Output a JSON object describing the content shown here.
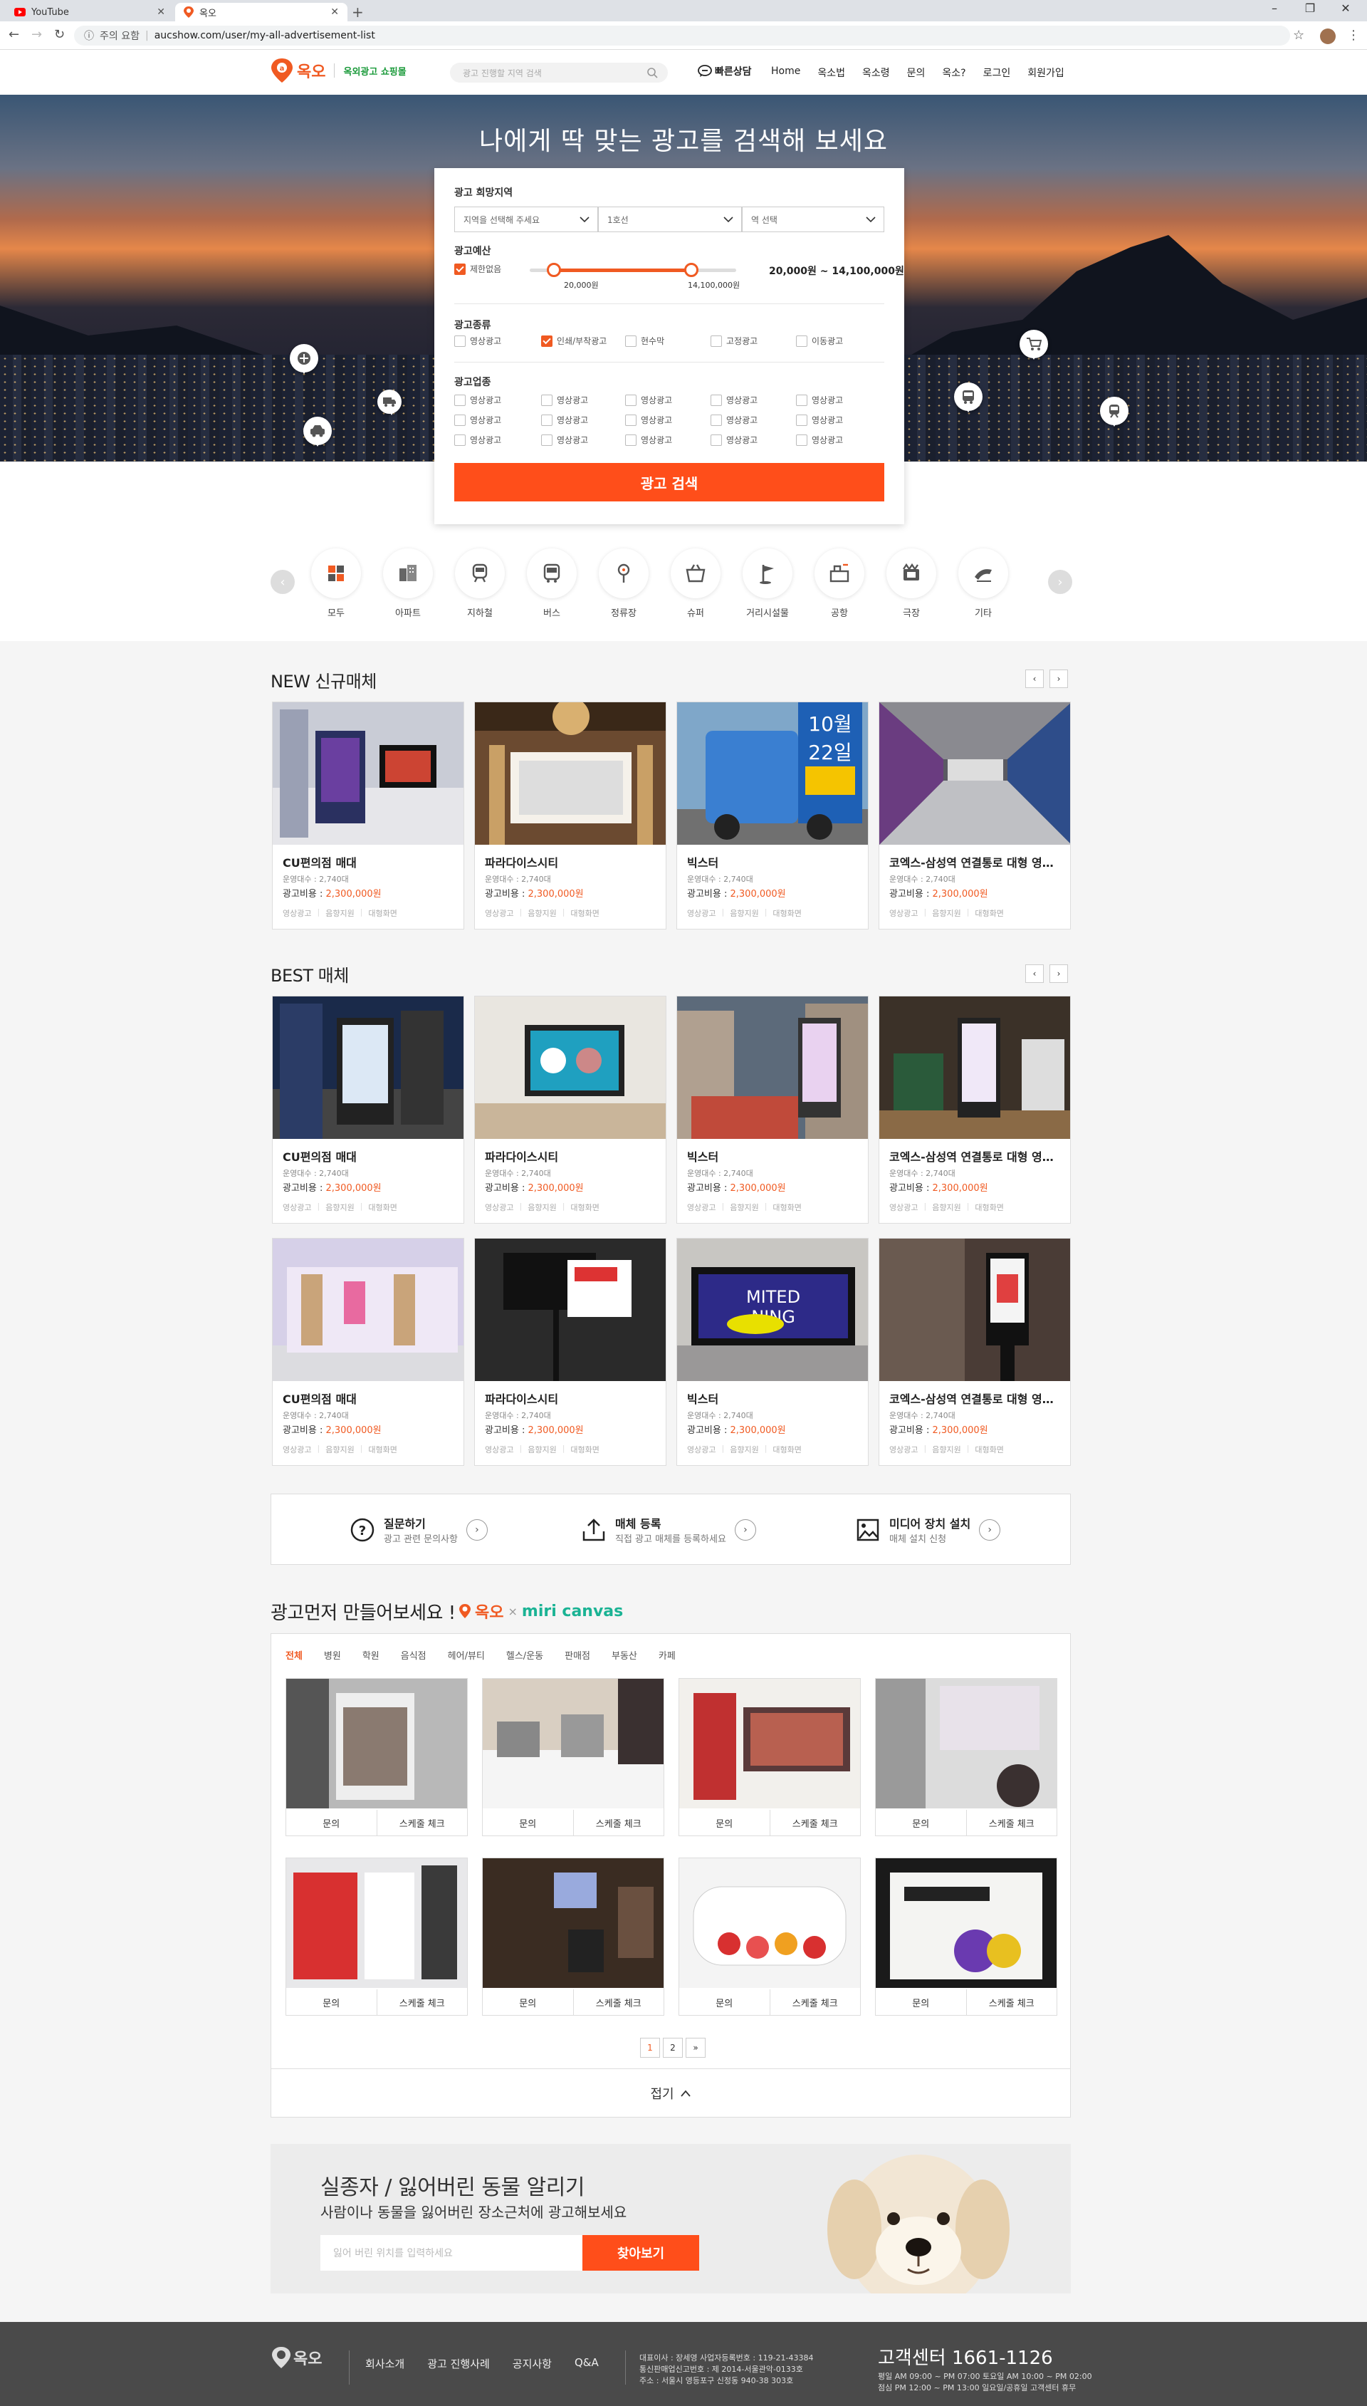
{
  "browser": {
    "tabs": [
      {
        "label": "YouTube"
      },
      {
        "label": "옥오"
      }
    ],
    "security": "주의 요함",
    "url": "aucshow.com/user/my-all-advertisement-list"
  },
  "header": {
    "logo_text": "옥오",
    "logo_sub": "옥외광고 쇼핑몰",
    "search_placeholder": "광고 진행할 지역 검색",
    "quick_label": "빠른상담",
    "nav": [
      "Home",
      "옥소법",
      "옥소령",
      "문의",
      "옥소?",
      "로그인",
      "회원가입"
    ]
  },
  "hero": {
    "title": "나에게 딱 맞는 광고를 검색해 보세요"
  },
  "search_panel": {
    "region_label": "광고 희망지역",
    "region_selects": [
      "지역을 선택해 주세요",
      "1호선",
      "역 선택"
    ],
    "budget_label": "광고예산",
    "unlimited_label": "제한없음",
    "slider_min": "20,000원",
    "slider_max": "14,100,000원",
    "range_text": "20,000원 ~ 14,100,000원",
    "type_label": "광고종류",
    "types": [
      "영상광고",
      "인쇄/부착광고",
      "현수막",
      "고정광고",
      "이동광고"
    ],
    "industry_label": "광고업종",
    "industry_item": "영상광고",
    "search_button": "광고 검색"
  },
  "categories": [
    "모두",
    "아파트",
    "지하철",
    "버스",
    "정류장",
    "슈퍼",
    "거리시설물",
    "공항",
    "극장",
    "기타"
  ],
  "new_section": {
    "title": "NEW 신규매체"
  },
  "best_section": {
    "title": "BEST 매체"
  },
  "card_common": {
    "operator": "운영대수 : 2,740대",
    "price_label": "광고비용 : ",
    "price": "2,300,000원",
    "tags": [
      "영상광고",
      "음향지원",
      "대형화면"
    ]
  },
  "card_names": [
    "CU편의점 매대",
    "파라다이스시티",
    "빅스터",
    "코엑스-삼성역 연결통로 대형 영상광고"
  ],
  "shortcuts": [
    {
      "title": "질문하기",
      "desc": "광고 관련 문의사항"
    },
    {
      "title": "매체 등록",
      "desc": "직접 광고 매체를 등록하세요"
    },
    {
      "title": "미디어 장치 설치",
      "desc": "매체 설치 신청"
    }
  ],
  "gallery": {
    "title": "광고먼저 만들어보세요 !",
    "brand_a": "옥오",
    "brand_x": "×",
    "brand_b": "miri canvas",
    "tabs": [
      "전체",
      "병원",
      "학원",
      "음식점",
      "헤어/뷰티",
      "헬스/운동",
      "판매점",
      "부동산",
      "카페"
    ],
    "btn_inquiry": "문의",
    "btn_schedule": "스케줄 체크",
    "pages": [
      "1",
      "2",
      "»"
    ],
    "collapse": "접기"
  },
  "banner": {
    "title": "실종자 / 잃어버린 동물 알리기",
    "subtitle": "사람이나 동물을 잃어버린 장소근처에 광고해보세요",
    "input_placeholder": "잃어 버린 위치를 입력하세요",
    "button": "찾아보기"
  },
  "footer": {
    "logo": "옥오",
    "nav": [
      "회사소개",
      "광고 진행사례",
      "공지사항",
      "Q&A"
    ],
    "info": [
      "대표이사 : 장세영    사업자등록번호 : 119-21-43384",
      "통신판매업신고번호 : 제 2014-서울관악-0133호",
      "주소 : 서울시 영등포구 신정동 940-38 303호"
    ],
    "cs": "고객센터 1661-1126",
    "hours": [
      "평일 AM 09:00 ~ PM 07:00  토요일 AM 10:00 ~ PM 02:00",
      "점심 PM 12:00 ~ PM 13:00  일요일/공휴일 고객센터 휴무"
    ]
  },
  "colors": {
    "accent": "#ff4e1a",
    "brand": "#f05a22",
    "footer": "#4a4a4a"
  }
}
